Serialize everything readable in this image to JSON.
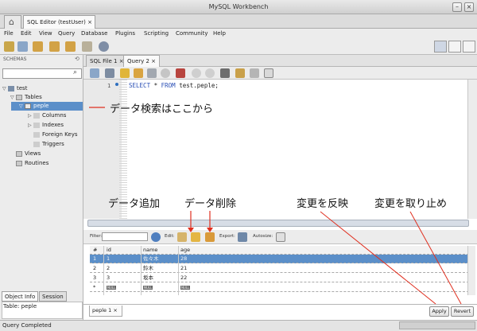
{
  "window": {
    "title": "MySQL Workbench"
  },
  "tabs": {
    "editor_tab": "SQL Editor (testUser)"
  },
  "menu": [
    "File",
    "Edit",
    "View",
    "Query",
    "Database",
    "Plugins",
    "Scripting",
    "Community",
    "Help"
  ],
  "sidebar": {
    "header": "SCHEMAS",
    "tree": {
      "schema": "test",
      "tables_folder": "Tables",
      "table": "peple",
      "children": [
        "Columns",
        "Indexes",
        "Foreign Keys",
        "Triggers"
      ],
      "views": "Views",
      "routines": "Routines"
    },
    "info_tabs": [
      "Object Info",
      "Session"
    ],
    "info_text": "Table: peple"
  },
  "editor": {
    "tabs": [
      "SQL File 1",
      "Query 2"
    ],
    "line_number": "1",
    "sql": {
      "kw1": "SELECT",
      "star": " * ",
      "kw2": "FROM",
      "rest": " test.peple;"
    }
  },
  "result": {
    "filter_label": "Filter:",
    "edit_label": "Edit:",
    "export_label": "Export:",
    "autosize_label": "Autosize:",
    "columns": [
      "#",
      "id",
      "name",
      "age"
    ],
    "rows": [
      [
        "1",
        "1",
        "佐々木",
        "28"
      ],
      [
        "2",
        "2",
        "鈴木",
        "21"
      ],
      [
        "3",
        "3",
        "坂本",
        "22"
      ]
    ],
    "new_row_marker": "*",
    "null_label": "NULL",
    "bottom_tab": "peple 1",
    "apply_label": "Apply",
    "revert_label": "Revert"
  },
  "status": {
    "text": "Query Completed"
  },
  "annotations": {
    "search": "データ検索はここから",
    "add": "データ追加",
    "delete": "データ削除",
    "apply": "変更を反映",
    "revert": "変更を取り止め"
  },
  "colors": {
    "selection": "#5b8fc9",
    "annotation_line": "#e03020",
    "keyword": "#2a4fb5"
  }
}
